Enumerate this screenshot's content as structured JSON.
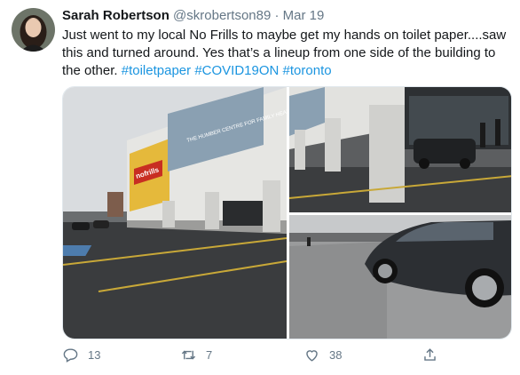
{
  "tweet": {
    "author_name": "Sarah Robertson",
    "author_handle": "@skrobertson89",
    "separator": "·",
    "date": "Mar 19",
    "text_plain": "Just went to my local No Frills to maybe get my hands on toilet paper....saw this and turned around. Yes that’s a lineup from one side of the building to the other.",
    "hashtags": [
      "#toiletpaper",
      "#COVID19ON",
      "#toronto"
    ],
    "photos": [
      {
        "store_sign": "nofrills",
        "banner": "THE HUMBER CENTRE FOR FAMILY HEALTH"
      },
      {
        "banner": ""
      },
      {
        "banner": ""
      }
    ],
    "actions": {
      "reply_count": "13",
      "retweet_count": "7",
      "like_count": "38"
    }
  },
  "colors": {
    "text": "#14171a",
    "secondary": "#657786",
    "link": "#1b95e0"
  },
  "icons": [
    "reply-icon",
    "retweet-icon",
    "like-icon",
    "share-icon"
  ]
}
